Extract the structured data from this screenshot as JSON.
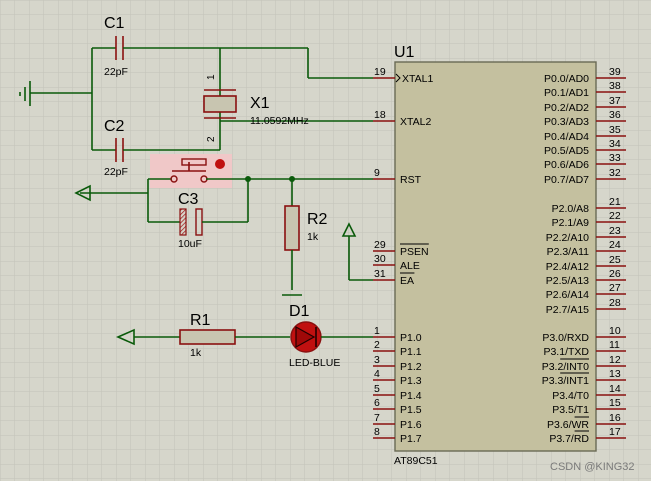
{
  "components": {
    "c1": {
      "ref": "C1",
      "value": "22pF"
    },
    "c2": {
      "ref": "C2",
      "value": "22pF"
    },
    "c3": {
      "ref": "C3",
      "value": "10uF"
    },
    "x1": {
      "ref": "X1",
      "value": "11.0592MHz",
      "pin_a": "1",
      "pin_b": "2"
    },
    "r1": {
      "ref": "R1",
      "value": "1k"
    },
    "r2": {
      "ref": "R2",
      "value": "1k"
    },
    "d1": {
      "ref": "D1",
      "value": "LED-BLUE"
    },
    "u1": {
      "ref": "U1",
      "part": "AT89C51"
    }
  },
  "u1_pins_left": [
    {
      "num": "19",
      "name": "XTAL1"
    },
    {
      "num": "18",
      "name": "XTAL2"
    },
    {
      "num": "9",
      "name": "RST"
    },
    {
      "num": "29",
      "name": "PSEN"
    },
    {
      "num": "30",
      "name": "ALE"
    },
    {
      "num": "31",
      "name": "EA"
    },
    {
      "num": "1",
      "name": "P1.0"
    },
    {
      "num": "2",
      "name": "P1.1"
    },
    {
      "num": "3",
      "name": "P1.2"
    },
    {
      "num": "4",
      "name": "P1.3"
    },
    {
      "num": "5",
      "name": "P1.4"
    },
    {
      "num": "6",
      "name": "P1.5"
    },
    {
      "num": "7",
      "name": "P1.6"
    },
    {
      "num": "8",
      "name": "P1.7"
    }
  ],
  "u1_pins_right": [
    {
      "num": "39",
      "name": "P0.0/AD0"
    },
    {
      "num": "38",
      "name": "P0.1/AD1"
    },
    {
      "num": "37",
      "name": "P0.2/AD2"
    },
    {
      "num": "36",
      "name": "P0.3/AD3"
    },
    {
      "num": "35",
      "name": "P0.4/AD4"
    },
    {
      "num": "34",
      "name": "P0.5/AD5"
    },
    {
      "num": "33",
      "name": "P0.6/AD6"
    },
    {
      "num": "32",
      "name": "P0.7/AD7"
    },
    {
      "num": "21",
      "name": "P2.0/A8"
    },
    {
      "num": "22",
      "name": "P2.1/A9"
    },
    {
      "num": "23",
      "name": "P2.2/A10"
    },
    {
      "num": "24",
      "name": "P2.3/A11"
    },
    {
      "num": "25",
      "name": "P2.4/A12"
    },
    {
      "num": "26",
      "name": "P2.5/A13"
    },
    {
      "num": "27",
      "name": "P2.6/A14"
    },
    {
      "num": "28",
      "name": "P2.7/A15"
    },
    {
      "num": "10",
      "name": "P3.0/RXD"
    },
    {
      "num": "11",
      "name": "P3.1/TXD"
    },
    {
      "num": "12",
      "name": "P3.2/INT0"
    },
    {
      "num": "13",
      "name": "P3.3/INT1"
    },
    {
      "num": "14",
      "name": "P3.4/T0"
    },
    {
      "num": "15",
      "name": "P3.5/T1"
    },
    {
      "num": "16",
      "name": "P3.6/WR"
    },
    {
      "num": "17",
      "name": "P3.7/RD"
    }
  ],
  "watermark": "CSDN @KING32",
  "colors": {
    "background": "#d6d6cb",
    "grid": "#c3c3b8",
    "wire": "#0a5a0a",
    "pin": "#8a1010",
    "chip_body": "#c4c09f",
    "highlight": "#f0c8c8",
    "led_fill": "#c01010"
  }
}
